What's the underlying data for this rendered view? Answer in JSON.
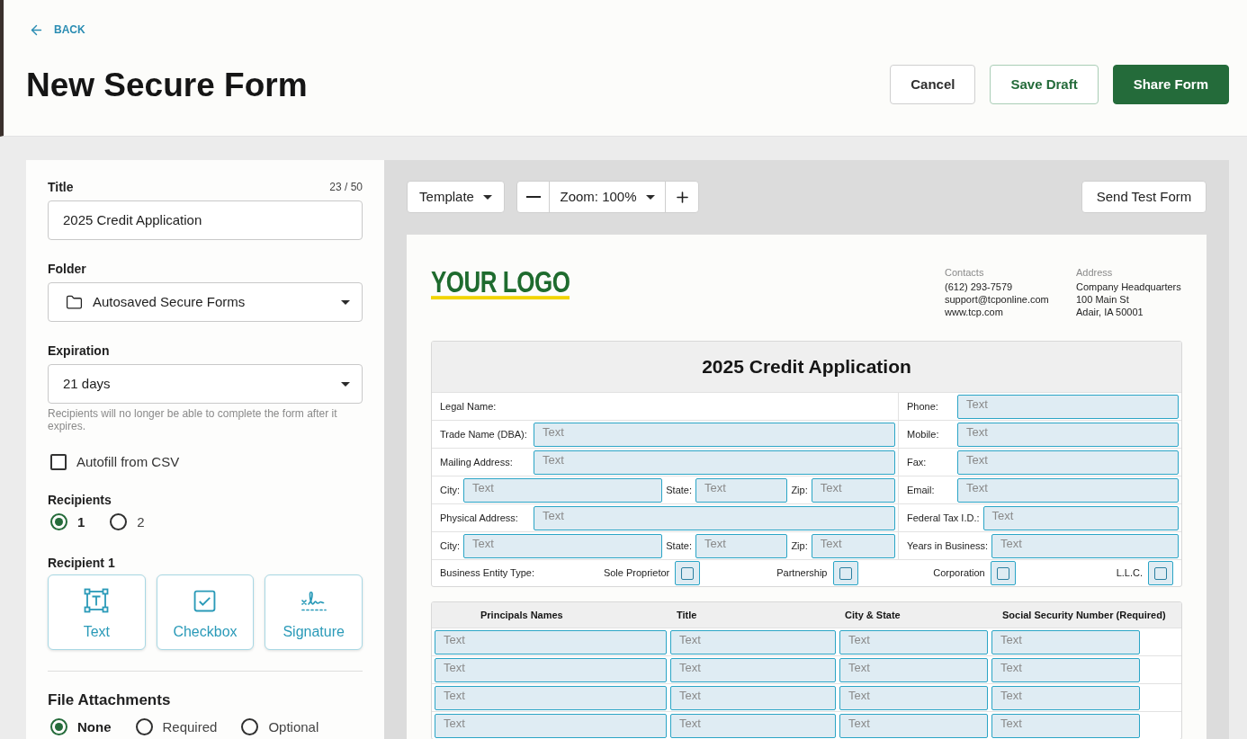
{
  "back_link": {
    "label": "BACK"
  },
  "page_title": "New Secure Form",
  "header_buttons": [
    {
      "label": "Cancel",
      "kind": "outline"
    },
    {
      "label": "Save Draft",
      "kind": "secondary"
    },
    {
      "label": "Share Form",
      "kind": "primary"
    }
  ],
  "settings": {
    "title_field": {
      "label": "Title",
      "counter": "23 / 50",
      "value": "2025 Credit Application"
    },
    "folder": {
      "label": "Folder",
      "value": "Autosaved Secure Forms"
    },
    "expiration": {
      "label": "Expiration",
      "value": "21 days",
      "helper": "Recipients will no longer be able to complete the form after it expires."
    },
    "autofill": {
      "label": "Autofill from CSV",
      "checked": false
    },
    "recipients": {
      "label": "Recipients",
      "options": [
        {
          "label": "1",
          "selected": true
        },
        {
          "label": "2",
          "selected": false
        }
      ]
    },
    "recipient_fields": {
      "label": "Recipient 1",
      "tools": [
        {
          "label": "Text",
          "kind": "text"
        },
        {
          "label": "Checkbox",
          "kind": "checkbox"
        },
        {
          "label": "Signature",
          "kind": "signature"
        }
      ]
    },
    "file_attachments": {
      "label": "File Attachments",
      "options": [
        {
          "label": "None",
          "selected": true
        },
        {
          "label": "Required",
          "selected": false
        },
        {
          "label": "Optional",
          "selected": false
        }
      ]
    }
  },
  "toolbar": {
    "template": "Template",
    "zoom": "Zoom: 100%",
    "send_test": "Send Test Form"
  },
  "document": {
    "logo": "YOUR LOGO",
    "contacts": {
      "heading": "Contacts",
      "lines": [
        "(612) 293-7579",
        "support@tcponline.com",
        "www.tcp.com"
      ]
    },
    "address": {
      "heading": "Address",
      "lines": [
        "Company Headquarters",
        "100 Main St",
        "Adair, IA 50001"
      ]
    },
    "application": {
      "title": "2025 Credit Application",
      "rows": [
        {
          "left": [
            {
              "kind": "label",
              "text": "Legal Name:"
            }
          ],
          "right": [
            {
              "kind": "label",
              "text": "Phone:"
            },
            {
              "kind": "field",
              "placeholder": "Text"
            }
          ]
        },
        {
          "left": [
            {
              "kind": "label",
              "text": "Trade Name (DBA):"
            },
            {
              "kind": "field",
              "placeholder": "Text"
            }
          ],
          "right": [
            {
              "kind": "label",
              "text": "Mobile:"
            },
            {
              "kind": "field",
              "placeholder": "Text"
            }
          ]
        },
        {
          "left": [
            {
              "kind": "label",
              "text": "Mailing Address:"
            },
            {
              "kind": "field",
              "placeholder": "Text"
            }
          ],
          "right": [
            {
              "kind": "label",
              "text": "Fax:"
            },
            {
              "kind": "field",
              "placeholder": "Text"
            }
          ]
        },
        {
          "left": [
            {
              "kind": "label",
              "text": "City:"
            },
            {
              "kind": "field",
              "placeholder": "Text"
            },
            {
              "kind": "label",
              "text": "State:"
            },
            {
              "kind": "field",
              "placeholder": "Text"
            },
            {
              "kind": "label",
              "text": "Zip:"
            },
            {
              "kind": "field",
              "placeholder": "Text"
            }
          ],
          "right": [
            {
              "kind": "label",
              "text": "Email:"
            },
            {
              "kind": "field",
              "placeholder": "Text"
            }
          ]
        },
        {
          "left": [
            {
              "kind": "label",
              "text": "Physical Address:"
            },
            {
              "kind": "field",
              "placeholder": "Text"
            }
          ],
          "right": [
            {
              "kind": "label",
              "text": "Federal Tax I.D.:"
            },
            {
              "kind": "field",
              "placeholder": "Text"
            }
          ]
        },
        {
          "left": [
            {
              "kind": "label",
              "text": "City:"
            },
            {
              "kind": "field",
              "placeholder": "Text"
            },
            {
              "kind": "label",
              "text": "State:"
            },
            {
              "kind": "field",
              "placeholder": "Text"
            },
            {
              "kind": "label",
              "text": "Zip:"
            },
            {
              "kind": "field",
              "placeholder": "Text"
            }
          ],
          "right": [
            {
              "kind": "label",
              "text": "Years in Business:"
            },
            {
              "kind": "field",
              "placeholder": "Text"
            }
          ]
        }
      ],
      "entity_type": {
        "label": "Business Entity Type:",
        "options": [
          {
            "label": "Sole Proprietor",
            "checked": false
          },
          {
            "label": "Partnership",
            "checked": false
          },
          {
            "label": "Corporation",
            "checked": false
          },
          {
            "label": "L.L.C.",
            "checked": false
          }
        ]
      }
    },
    "principals": {
      "columns": [
        "Principals Names",
        "Title",
        "City & State",
        "Social Security Number (Required)"
      ],
      "rows": [
        [
          "Text",
          "Text",
          "Text",
          "Text"
        ],
        [
          "Text",
          "Text",
          "Text",
          "Text"
        ],
        [
          "Text",
          "Text",
          "Text",
          "Text"
        ],
        [
          "Text",
          "Text",
          "Text",
          "Text"
        ]
      ]
    }
  }
}
